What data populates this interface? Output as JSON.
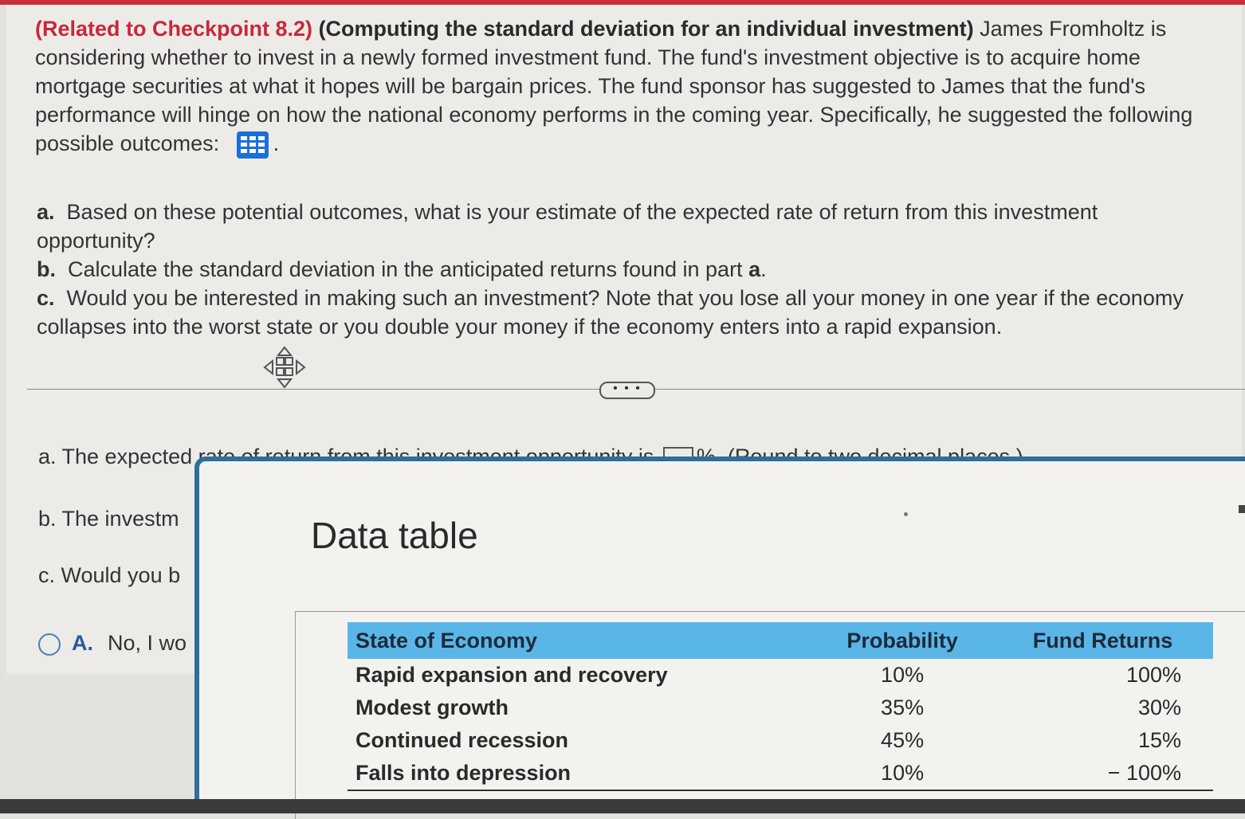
{
  "problem": {
    "tag": "(Related to Checkpoint 8.2)",
    "title": "(Computing the standard deviation for an individual investment)",
    "body": "James Fromholtz is considering whether to invest in a newly formed investment fund. The fund's investment objective is to acquire home mortgage securities at what it hopes will be bargain prices. The fund sponsor has suggested to James that the fund's performance will hinge on how the national economy performs in the coming year. Specifically, he suggested the following possible outcomes:",
    "after_icon": "."
  },
  "parts": {
    "a_label": "a.",
    "a_text": "Based on these potential outcomes, what is your estimate of the expected rate of return from this investment opportunity?",
    "b_label": "b.",
    "b_text_pre": "Calculate the standard deviation in the anticipated returns found in part ",
    "b_text_bold": "a",
    "b_text_post": ".",
    "c_label": "c.",
    "c_text": "Would you be interested in making such an investment? Note that you lose all your money in one year if the economy collapses into the worst state or you double your money if the economy enters into a rapid expansion."
  },
  "more_label": "• • •",
  "answers": {
    "a_text": "a.  The expected rate of return from this investment opportunity is",
    "a_suffix": "%.  (Round to two decimal places.)",
    "b_text": "b.  The investm",
    "c_text": "c.  Would you b",
    "option_letter": "A.",
    "option_text": "No, I wo"
  },
  "modal": {
    "title": "Data table",
    "headers": [
      "State of Economy",
      "Probability",
      "Fund Returns"
    ],
    "rows": [
      {
        "state": "Rapid expansion and recovery",
        "probability": "10%",
        "returns": "100%"
      },
      {
        "state": "Modest growth",
        "probability": "35%",
        "returns": "30%"
      },
      {
        "state": "Continued recession",
        "probability": "45%",
        "returns": "15%"
      },
      {
        "state": "Falls into depression",
        "probability": "10%",
        "returns": "− 100%"
      }
    ]
  },
  "colors": {
    "accent_red": "#c8283a",
    "table_header": "#5bb6e8",
    "modal_border": "#2d6f9a",
    "icon_blue": "#1d6fd8"
  },
  "icons": {
    "data_table": "grid-icon",
    "move": "move-arrows-icon"
  }
}
